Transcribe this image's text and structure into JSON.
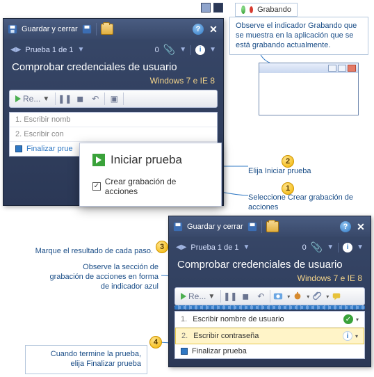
{
  "top_strip": {},
  "panelA": {
    "save_close": "Guardar y cerrar",
    "test_nav": "Prueba 1 de 1",
    "zero": "0",
    "title": "Comprobar credenciales de usuario",
    "env": "Windows 7 e IE 8",
    "toolbar": {
      "replay_label": "Re..."
    },
    "steps": {
      "s1": "1. Escribir nomb",
      "s2": "2. Escribir con",
      "s3": "Finalizar prue"
    }
  },
  "popup": {
    "start": "Iniciar prueba",
    "record_chk": "Crear grabación de acciones"
  },
  "recording": {
    "label": "Grabando",
    "callout": "Observe el indicador Grabando que se muestra en la aplicación que se está grabando actualmente."
  },
  "callouts": {
    "c1": "Seleccione Crear grabación de acciones",
    "c2": "Elija Iniciar prueba",
    "c3": "Marque el resultado de cada paso.",
    "c4a": "Observe la sección de",
    "c4b": "grabación de acciones en forma",
    "c4c": "de indicador azul",
    "c5a": "Cuando termine la prueba,",
    "c5b": "elija Finalizar prueba"
  },
  "badges": {
    "n1": "1",
    "n2": "2",
    "n3": "3",
    "n4": "4"
  },
  "panelB": {
    "save_close": "Guardar y cerrar",
    "test_nav": "Prueba 1 de 1",
    "zero": "0",
    "title": "Comprobar credenciales de usuario",
    "env": "Windows 7 e IE 8",
    "toolbar": {
      "replay_label": "Re..."
    },
    "steps": {
      "s1": "Escribir nombre de usuario",
      "s1n": "1.",
      "s2": "Escribir contraseña",
      "s2n": "2.",
      "s3": "Finalizar prueba"
    }
  }
}
